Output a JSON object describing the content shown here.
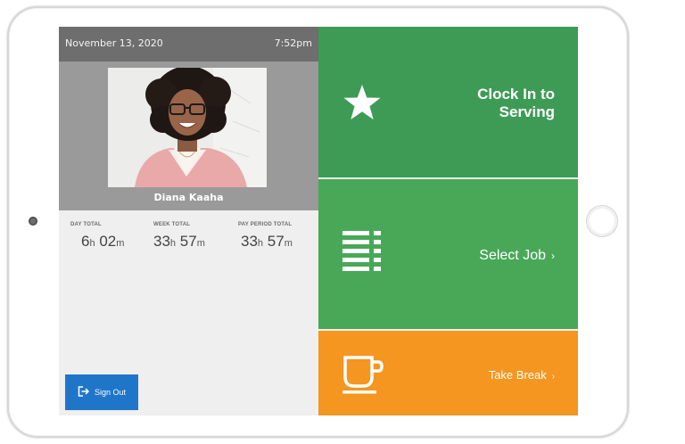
{
  "header": {
    "date": "November 13, 2020",
    "time": "7:52pm"
  },
  "profile": {
    "name": "Diana Kaaha"
  },
  "totals": [
    {
      "label": "DAY TOTAL",
      "hours": "6",
      "minutes": "02"
    },
    {
      "label": "WEEK TOTAL",
      "hours": "33",
      "minutes": "57"
    },
    {
      "label": "PAY PERIOD TOTAL",
      "hours": "33",
      "minutes": "57"
    }
  ],
  "units": {
    "hours": "h",
    "minutes": "m"
  },
  "sign_out": {
    "label": "Sign Out",
    "icon": "sign-out-icon"
  },
  "actions": {
    "clock_in": {
      "line1": "Clock In to",
      "line2": "Serving",
      "icon": "star-icon",
      "color": "#3e9b55"
    },
    "select_job": {
      "label": "Select Job",
      "chevron": "›",
      "icon": "list-icon",
      "color": "#48a857"
    },
    "take_break": {
      "label": "Take Break",
      "chevron": "›",
      "icon": "coffee-cup-icon",
      "color": "#f4961f"
    }
  }
}
